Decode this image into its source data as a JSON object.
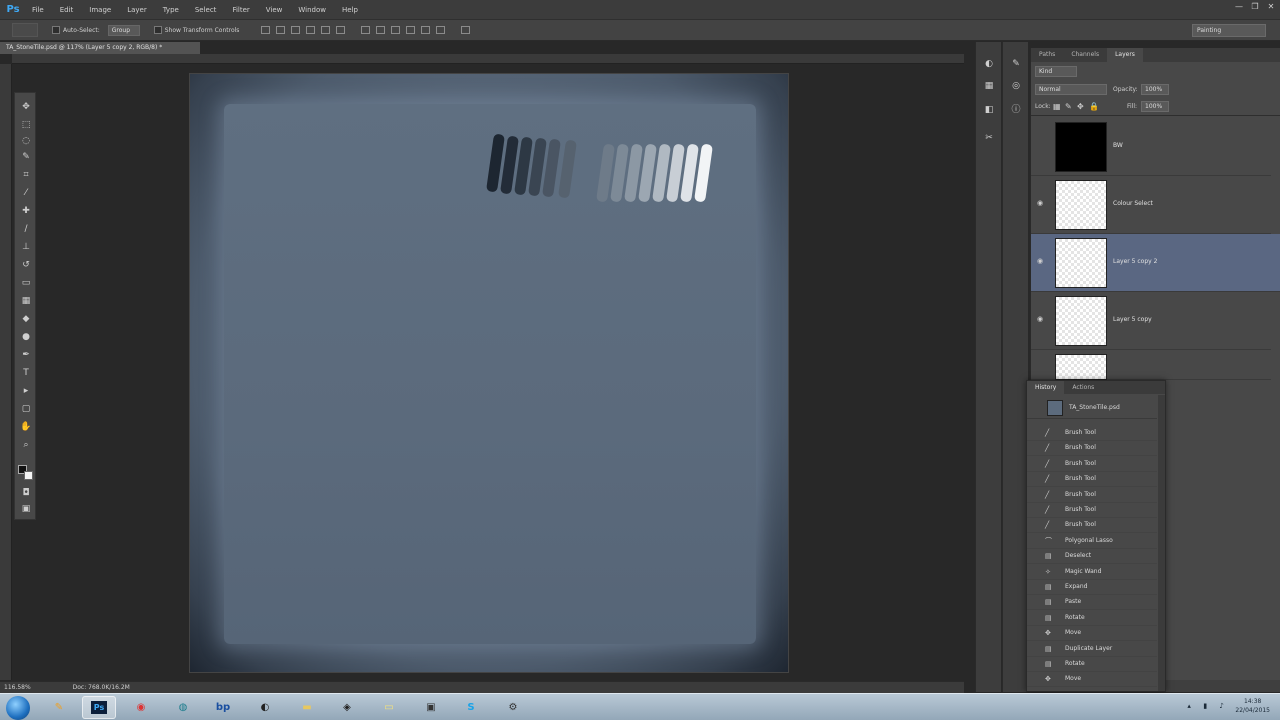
{
  "app": {
    "logo": "Ps",
    "menu": [
      "File",
      "Edit",
      "Image",
      "Layer",
      "Type",
      "Select",
      "Filter",
      "View",
      "Window",
      "Help"
    ],
    "window_controls": [
      "—",
      "❐",
      "✕"
    ]
  },
  "options": {
    "auto_select_label": "Auto-Select:",
    "auto_select_value": "Group",
    "show_transform_label": "Show Transform Controls",
    "workspace": "Painting"
  },
  "document": {
    "tab_title": "TA_StoneTile.psd @ 117% (Layer 5 copy 2, RGB/8) *",
    "zoom": "116.58%",
    "doc_info": "Doc: 768.0K/16.2M"
  },
  "layers_panel": {
    "tabs": [
      "Paths",
      "Channels",
      "Layers"
    ],
    "active_tab": "Layers",
    "kind_value": "Kind",
    "blend_mode": "Normal",
    "opacity_label": "Opacity:",
    "opacity_value": "100%",
    "lock_label": "Lock:",
    "fill_label": "Fill:",
    "fill_value": "100%",
    "layers": [
      {
        "name": "BW",
        "thumb": "black",
        "selected": false
      },
      {
        "name": "Colour Select",
        "thumb": "transparent",
        "selected": false
      },
      {
        "name": "Layer 5 copy 2",
        "thumb": "transparent",
        "selected": true
      },
      {
        "name": "Layer 5 copy",
        "thumb": "transparent",
        "selected": false
      }
    ]
  },
  "history_panel": {
    "tabs": [
      "History",
      "Actions"
    ],
    "snapshot": "TA_StoneTile.psd",
    "items": [
      {
        "label": "Brush Tool",
        "icon": "brush-icon"
      },
      {
        "label": "Brush Tool",
        "icon": "brush-icon"
      },
      {
        "label": "Brush Tool",
        "icon": "brush-icon"
      },
      {
        "label": "Brush Tool",
        "icon": "brush-icon"
      },
      {
        "label": "Brush Tool",
        "icon": "brush-icon"
      },
      {
        "label": "Brush Tool",
        "icon": "brush-icon"
      },
      {
        "label": "Brush Tool",
        "icon": "brush-icon"
      },
      {
        "label": "Polygonal Lasso",
        "icon": "lasso-icon"
      },
      {
        "label": "Deselect",
        "icon": "document-icon"
      },
      {
        "label": "Magic Wand",
        "icon": "magic-wand-icon"
      },
      {
        "label": "Expand",
        "icon": "document-icon"
      },
      {
        "label": "Paste",
        "icon": "document-icon"
      },
      {
        "label": "Rotate",
        "icon": "document-icon"
      },
      {
        "label": "Move",
        "icon": "move-icon"
      },
      {
        "label": "Duplicate Layer",
        "icon": "document-icon"
      },
      {
        "label": "Rotate",
        "icon": "document-icon"
      },
      {
        "label": "Move",
        "icon": "move-icon"
      }
    ]
  },
  "taskbar": {
    "apps": [
      "ie",
      "pencil-app",
      "photoshop",
      "chrome",
      "globe-app",
      "bp",
      "obs",
      "folder",
      "unity",
      "sticky-notes",
      "terminal",
      "skype",
      "tool-app"
    ],
    "active_app": "photoshop",
    "time": "14:38",
    "date": "22/04/2015"
  }
}
